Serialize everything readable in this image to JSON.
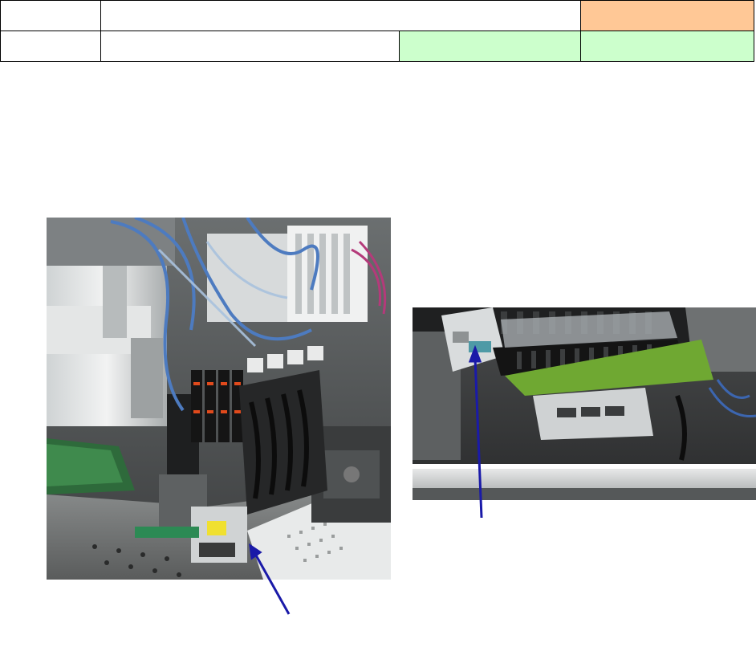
{
  "header": {
    "row1": {
      "c1": "",
      "c2": "",
      "c3": ""
    },
    "row2": {
      "c1": "",
      "c2": "",
      "c3": "",
      "c4": ""
    }
  },
  "colors": {
    "highlight_orange": "#ffc896",
    "highlight_green": "#ccffcc",
    "arrow": "#1a1aa8"
  },
  "photos": {
    "left": {
      "subject": "placement-head-assembly-photo"
    },
    "right": {
      "subject": "head-camera-unit-photo"
    }
  }
}
